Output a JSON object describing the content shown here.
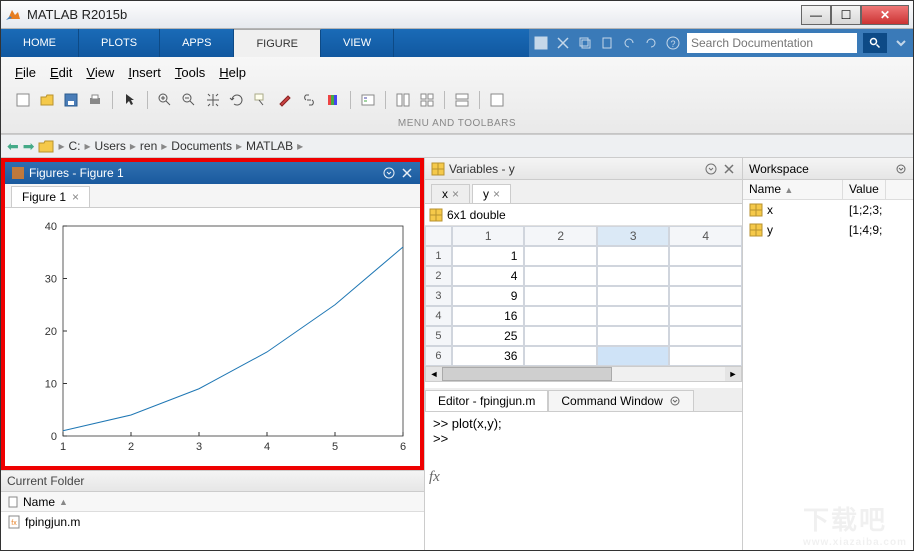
{
  "app": {
    "title": "MATLAB R2015b"
  },
  "toolstrip": {
    "tabs": {
      "home": "HOME",
      "plots": "PLOTS",
      "apps": "APPS",
      "figure": "FIGURE",
      "view": "VIEW"
    },
    "search_placeholder": "Search Documentation"
  },
  "menubar": {
    "file": "File",
    "edit": "Edit",
    "view": "View",
    "insert": "Insert",
    "tools": "Tools",
    "help": "Help"
  },
  "menulabel": "MENU AND TOOLBARS",
  "breadcrumb": {
    "c": "C:",
    "users": "Users",
    "ren": "ren",
    "documents": "Documents",
    "matlab": "MATLAB"
  },
  "figures": {
    "title": "Figures - Figure 1",
    "tab": "Figure 1"
  },
  "currentfolder": {
    "title": "Current Folder",
    "col_name": "Name",
    "file1": "fpingjun.m"
  },
  "variables": {
    "title": "Variables - y",
    "tab_x": "x",
    "tab_y": "y",
    "type": "6x1 double",
    "cols": {
      "c1": "1",
      "c2": "2",
      "c3": "3",
      "c4": "4"
    },
    "rows": {
      "r1": "1",
      "r2": "2",
      "r3": "3",
      "r4": "4",
      "r5": "5",
      "r6": "6"
    },
    "vals": {
      "v1": "1",
      "v2": "4",
      "v3": "9",
      "v4": "16",
      "v5": "25",
      "v6": "36"
    }
  },
  "editor": {
    "tab_editor": "Editor - fpingjun.m",
    "tab_cmd": "Command Window"
  },
  "command": {
    "line1": ">> plot(x,y);",
    "line2": ">> "
  },
  "workspace": {
    "title": "Workspace",
    "col_name": "Name",
    "col_value": "Value",
    "var1_name": "x",
    "var1_value": "[1;2;3;",
    "var2_name": "y",
    "var2_value": "[1;4;9;"
  },
  "watermark": {
    "main": "下载吧",
    "sub": "www.xiazaiba.com"
  },
  "chart_data": {
    "type": "line",
    "x": [
      1,
      2,
      3,
      4,
      5,
      6
    ],
    "y": [
      1,
      4,
      9,
      16,
      25,
      36
    ],
    "xlabel": "",
    "ylabel": "",
    "xlim": [
      1,
      6
    ],
    "ylim": [
      0,
      40
    ],
    "xticks": [
      1,
      2,
      3,
      4,
      5,
      6
    ],
    "yticks": [
      0,
      10,
      20,
      30,
      40
    ],
    "title": ""
  }
}
